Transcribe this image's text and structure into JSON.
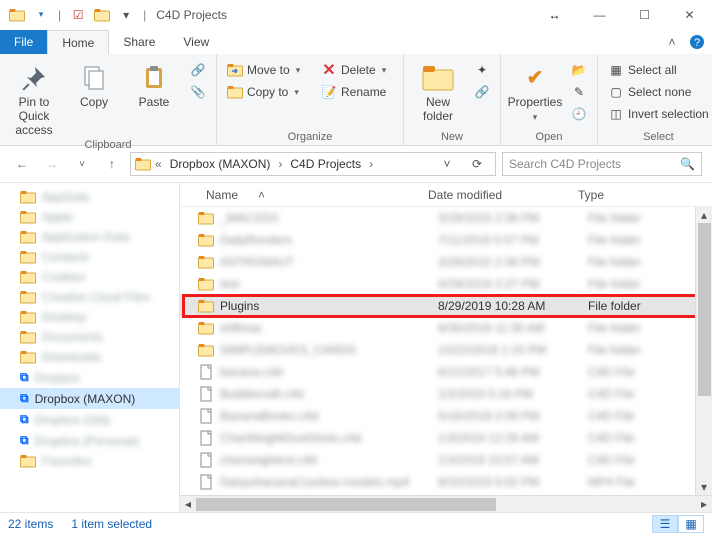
{
  "title": {
    "app": "C4D Projects"
  },
  "tabs": {
    "file": "File",
    "home": "Home",
    "share": "Share",
    "view": "View"
  },
  "ribbon": {
    "clipboard": {
      "label": "Clipboard",
      "pin": "Pin to Quick\naccess",
      "copy": "Copy",
      "paste": "Paste"
    },
    "organize": {
      "label": "Organize",
      "moveto": "Move to",
      "copyto": "Copy to",
      "delete": "Delete",
      "rename": "Rename"
    },
    "new": {
      "label": "New",
      "newfolder": "New\nfolder"
    },
    "open": {
      "label": "Open",
      "properties": "Properties"
    },
    "select": {
      "label": "Select",
      "all": "Select all",
      "none": "Select none",
      "invert": "Invert selection"
    }
  },
  "breadcrumb": {
    "root_hint": "«",
    "seg1": "Dropbox (MAXON)",
    "seg2": "C4D Projects"
  },
  "search": {
    "placeholder": "Search C4D Projects"
  },
  "columns": {
    "name": "Name",
    "date": "Date modified",
    "type": "Type"
  },
  "nav_items": [
    "AppData",
    "Apple",
    "Application Data",
    "Contacts",
    "Cookies",
    "Creative Cloud Files",
    "Desktop",
    "Documents",
    "Downloads",
    "Dropbox",
    "Dropbox (MAXON)",
    "Dropbox (Old)",
    "Dropbox (Personal)",
    "Favorites"
  ],
  "nav_selected_index": 10,
  "files": [
    {
      "name": "_MACOSX",
      "date": "3/29/2015 2:36 PM",
      "type": "File folder",
      "icon": "folder"
    },
    {
      "name": "DailyRenders",
      "date": "7/11/2019 5:07 PM",
      "type": "File folder",
      "icon": "folder"
    },
    {
      "name": "ASTRONAUT",
      "date": "3/29/2015 2:36 PM",
      "type": "File folder",
      "icon": "folder"
    },
    {
      "name": "test",
      "date": "5/29/2019 2:27 PM",
      "type": "File folder",
      "icon": "folder"
    },
    {
      "name": "Plugins",
      "date": "8/29/2019 10:28 AM",
      "type": "File folder",
      "icon": "folder"
    },
    {
      "name": "shffmax",
      "date": "8/30/2019 11:35 AM",
      "type": "File folder",
      "icon": "folder"
    },
    {
      "name": "SIMPLEMOVES_CARDS",
      "date": "10/22/2018 1:15 PM",
      "type": "File folder",
      "icon": "folder"
    },
    {
      "name": "banana.c4d",
      "date": "6/12/2017 5:46 PM",
      "type": "C4D File",
      "icon": "file"
    },
    {
      "name": "Bubblecraft.c4d",
      "date": "1/2/2019 5:16 PM",
      "type": "C4D File",
      "icon": "file"
    },
    {
      "name": "BananaBonko.c4d",
      "date": "5/16/2018 2:09 PM",
      "type": "C4D File",
      "icon": "file"
    },
    {
      "name": "CharWeightDustShots.c4d",
      "date": "1/3/2019 12:29 AM",
      "type": "C4D File",
      "icon": "file"
    },
    {
      "name": "charweightest.c4d",
      "date": "1/3/2019 10:57 AM",
      "type": "C4D File",
      "icon": "file"
    },
    {
      "name": "DaisyshacanaCryobox-models.mp4",
      "date": "8/10/2019 5:02 PM",
      "type": "MP4 File",
      "icon": "file"
    }
  ],
  "highlight_index": 4,
  "status": {
    "count": "22 items",
    "selected": "1 item selected"
  }
}
